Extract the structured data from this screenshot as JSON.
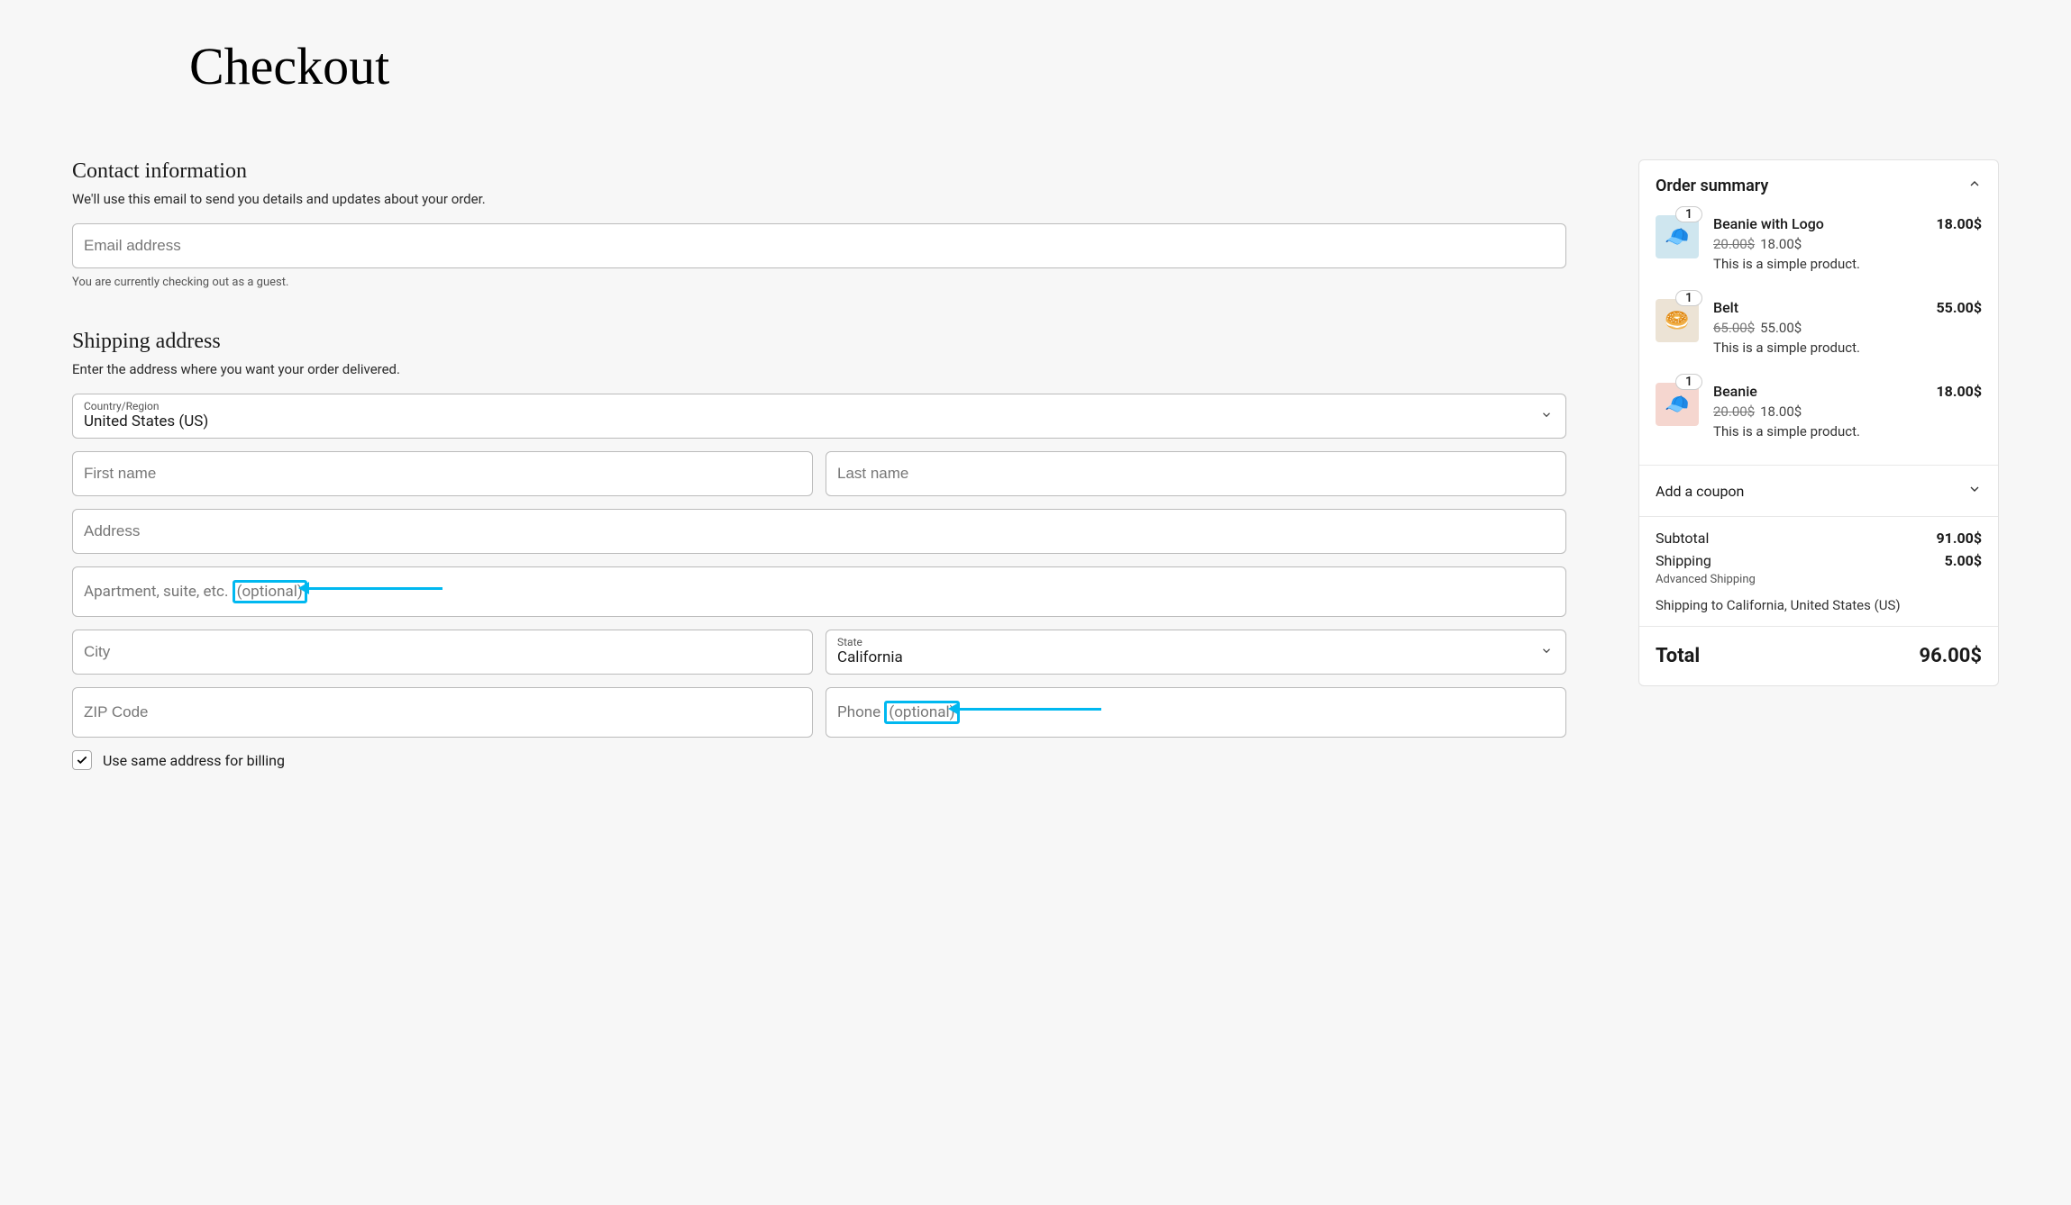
{
  "page_title": "Checkout",
  "contact": {
    "heading": "Contact information",
    "desc": "We'll use this email to send you details and updates about your order.",
    "email_placeholder": "Email address",
    "guest_note": "You are currently checking out as a guest."
  },
  "shipping": {
    "heading": "Shipping address",
    "desc": "Enter the address where you want your order delivered.",
    "country_label": "Country/Region",
    "country_value": "United States (US)",
    "first_name_placeholder": "First name",
    "last_name_placeholder": "Last name",
    "address_placeholder": "Address",
    "apt_placeholder_main": "Apartment, suite, etc. ",
    "apt_placeholder_optional": "(optional)",
    "city_placeholder": "City",
    "state_label": "State",
    "state_value": "California",
    "zip_placeholder": "ZIP Code",
    "phone_placeholder_main": "Phone ",
    "phone_placeholder_optional": "(optional)",
    "same_billing_label": "Use same address for billing"
  },
  "summary": {
    "heading": "Order summary",
    "items": [
      {
        "qty": "1",
        "name": "Beanie with Logo",
        "price": "18.00$",
        "old": "20.00$",
        "cur": "18.00$",
        "desc": "This is a simple product.",
        "emoji": "🧢",
        "thumb_bg": "#cfe6ef"
      },
      {
        "qty": "1",
        "name": "Belt",
        "price": "55.00$",
        "old": "65.00$",
        "cur": "55.00$",
        "desc": "This is a simple product.",
        "emoji": "🥯",
        "thumb_bg": "#ece3d5"
      },
      {
        "qty": "1",
        "name": "Beanie",
        "price": "18.00$",
        "old": "20.00$",
        "cur": "18.00$",
        "desc": "This is a simple product.",
        "emoji": "🧢",
        "thumb_bg": "#f5d6cf"
      }
    ],
    "coupon_label": "Add a coupon",
    "subtotal_label": "Subtotal",
    "subtotal_value": "91.00$",
    "shipping_label": "Shipping",
    "shipping_value": "5.00$",
    "shipping_method": "Advanced Shipping",
    "shipping_to": "Shipping to California, United States (US)",
    "total_label": "Total",
    "total_value": "96.00$"
  }
}
